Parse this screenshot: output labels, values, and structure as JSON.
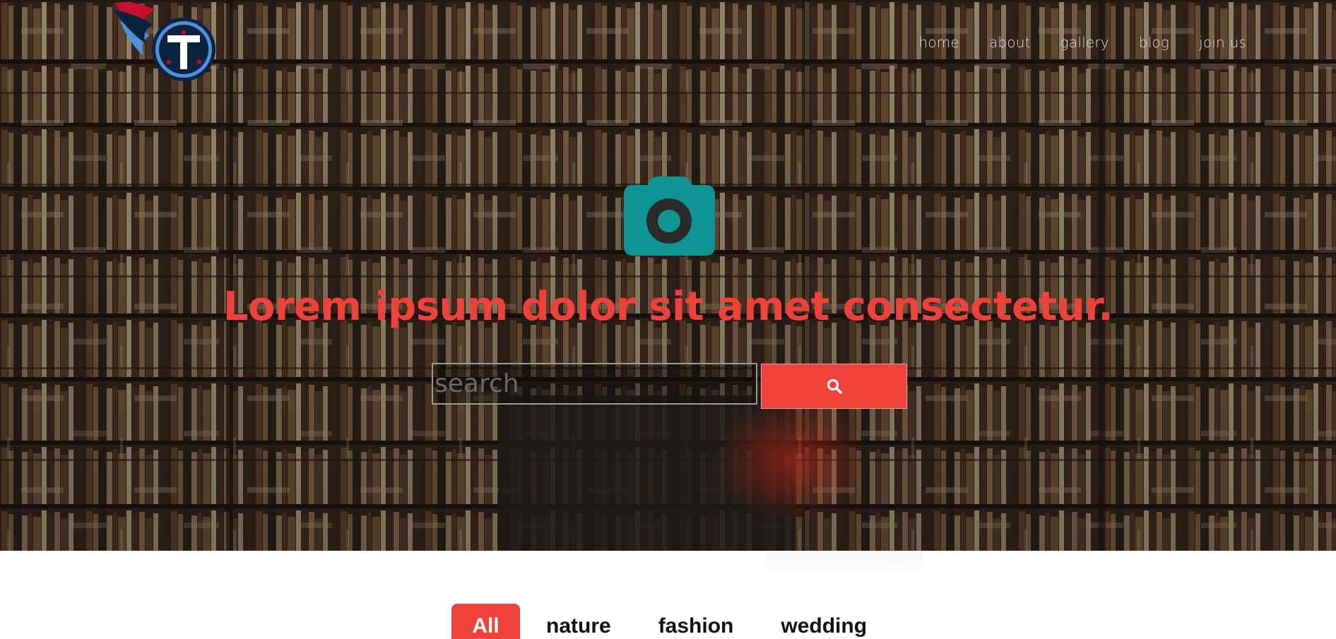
{
  "header": {
    "logo_icon": "titans-logo-icon",
    "nav": [
      {
        "label": "home"
      },
      {
        "label": "about"
      },
      {
        "label": "gallery"
      },
      {
        "label": "blog"
      },
      {
        "label": "join us"
      }
    ]
  },
  "hero": {
    "icon": "camera-icon",
    "headline": "Lorem ipsum dolor sit amet consectetur.",
    "search": {
      "placeholder": "search",
      "value": "",
      "button_icon": "search-icon"
    }
  },
  "filters": {
    "tabs": [
      {
        "label": "All",
        "active": true
      },
      {
        "label": "nature",
        "active": false
      },
      {
        "label": "fashion",
        "active": false
      },
      {
        "label": "wedding",
        "active": false
      }
    ]
  },
  "colors": {
    "accent": "#f0413a",
    "camera": "#0e9593",
    "nav_text": "#d6dde6"
  }
}
